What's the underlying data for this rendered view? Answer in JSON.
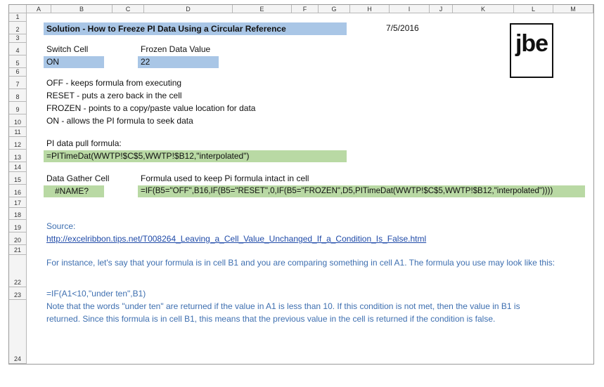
{
  "columns": [
    "A",
    "B",
    "C",
    "D",
    "E",
    "F",
    "G",
    "H",
    "I",
    "J",
    "K",
    "L",
    "M"
  ],
  "rows": [
    "1",
    "2",
    "3",
    "4",
    "5",
    "6",
    "7",
    "8",
    "9",
    "10",
    "11",
    "12",
    "13",
    "14",
    "15",
    "16",
    "17",
    "18",
    "19",
    "20",
    "21",
    "22",
    "23",
    "24"
  ],
  "title": "Solution - How to Freeze PI Data Using a Circular Reference",
  "date": "7/5/2016",
  "logo": "jbe",
  "switch_label": "Switch Cell",
  "frozen_label": "Frozen Data Value",
  "switch_value": "ON",
  "frozen_value": "22",
  "notes": [
    "OFF - keeps formula from executing",
    "RESET - puts a zero back in the cell",
    "FROZEN - points to a copy/paste value location for data",
    "ON - allows the PI formula to seek data"
  ],
  "pi_pull_label": "PI data pull formula:",
  "pi_formula": "=PITimeDat(WWTP!$C$5,WWTP!$B12,\"interpolated\")",
  "gather_label": "Data Gather Cell",
  "formula_intact_label": "Formula used to keep Pi formula intact in cell",
  "gather_value": "#NAME?",
  "if_formula": "=IF(B5=\"OFF\",B16,IF(B5=\"RESET\",0,IF(B5=\"FROZEN\",D5,PITimeDat(WWTP!$C$5,WWTP!$B12,\"interpolated\"))))",
  "source_label": "Source:",
  "source_url": "http://excelribbon.tips.net/T008264_Leaving_a_Cell_Value_Unchanged_If_a_Condition_Is_False.html",
  "instance_text": "For instance, let's say that your formula is in cell B1 and you are comparing something in cell A1. The formula you use may look like this:",
  "example_formula": "=IF(A1<10,\"under ten\",B1)",
  "note_line1": "Note that the words \"under ten\" are returned if the value in A1 is less than 10. If this condition is not met, then the value in B1 is",
  "note_line2": "returned. Since this formula is in cell B1, this means that the previous value in the cell is returned if the condition is false."
}
